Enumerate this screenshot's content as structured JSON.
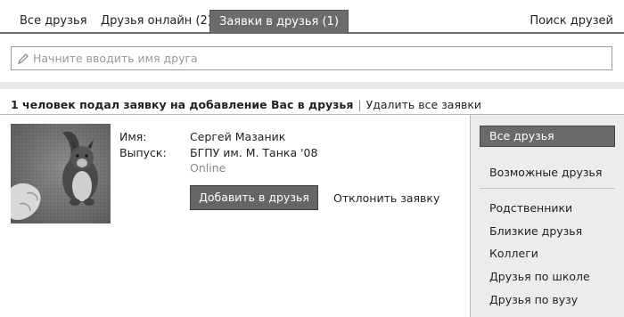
{
  "tabs": {
    "all_friends": "Все друзья",
    "friends_online": "Друзья онлайн (2)",
    "friend_requests": "Заявки в друзья (1)",
    "search_friends": "Поиск друзей"
  },
  "search": {
    "placeholder": "Начните вводить имя друга",
    "value": ""
  },
  "summary": {
    "text": "1 человек подал заявку на добавление Вас в друзья",
    "separator": "|",
    "delete_all": "Удалить все заявки"
  },
  "request": {
    "name_label": "Имя:",
    "name": "Сергей Мазаник",
    "graduation_label": "Выпуск:",
    "graduation": "БГПУ им. М. Танка '08",
    "status": "Online",
    "add_button": "Добавить в друзья",
    "decline_button": "Отклонить заявку"
  },
  "sidebar": {
    "items": [
      "Все друзья",
      "Возможные друзья",
      "Родственники",
      "Близкие друзья",
      "Коллеги",
      "Друзья по школе",
      "Друзья по вузу"
    ]
  },
  "icons": {
    "search": "search-icon"
  },
  "colors": {
    "active_tab": "#6b6b6b",
    "button": "#666666",
    "sidebar_bg": "#ececec"
  }
}
